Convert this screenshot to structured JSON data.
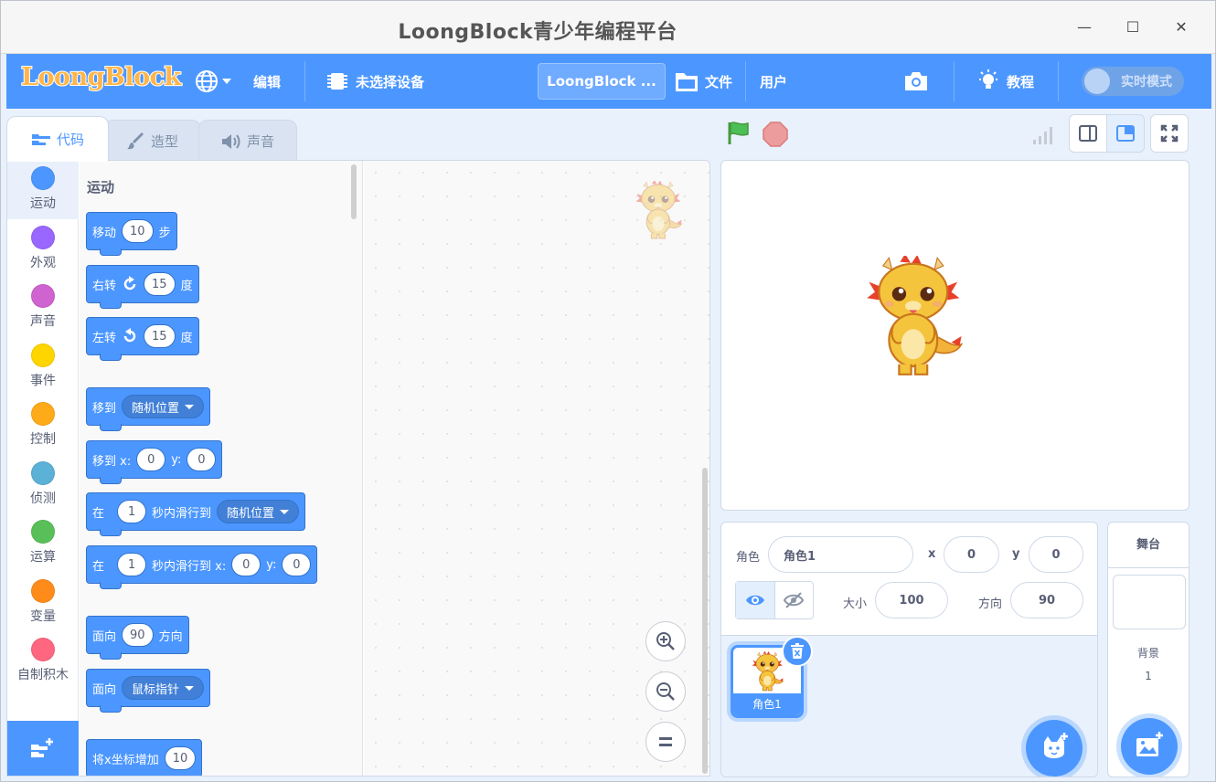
{
  "window": {
    "title": "LoongBlock青少年编程平台"
  },
  "menubar": {
    "logo": "LoongBlock",
    "edit": "编辑",
    "device": "未选择设备",
    "project_title": "LoongBlock ...",
    "file": "文件",
    "user": "用户",
    "tutorial": "教程",
    "realtime": "实时模式"
  },
  "tabs": {
    "code": "代码",
    "costume": "造型",
    "sound": "声音"
  },
  "categories": [
    {
      "label": "运动",
      "color": "#4c97ff"
    },
    {
      "label": "外观",
      "color": "#9966ff"
    },
    {
      "label": "声音",
      "color": "#cf63cf"
    },
    {
      "label": "事件",
      "color": "#ffd500"
    },
    {
      "label": "控制",
      "color": "#ffab19"
    },
    {
      "label": "侦测",
      "color": "#5cb1d6"
    },
    {
      "label": "运算",
      "color": "#59c059"
    },
    {
      "label": "变量",
      "color": "#ff8c1a"
    },
    {
      "label": "自制积木",
      "color": "#ff6680"
    }
  ],
  "palette": {
    "title": "运动",
    "move": {
      "a": "移动",
      "v": "10",
      "b": "步"
    },
    "turn_right": {
      "a": "右转",
      "v": "15",
      "b": "度"
    },
    "turn_left": {
      "a": "左转",
      "v": "15",
      "b": "度"
    },
    "goto": {
      "a": "移到",
      "dd": "随机位置"
    },
    "goto_xy": {
      "a": "移到 x:",
      "x": "0",
      "y_label": "y:",
      "y": "0"
    },
    "glide": {
      "a": "在",
      "v": "1",
      "b": "秒内滑行到",
      "dd": "随机位置"
    },
    "glide_xy": {
      "a": "在",
      "v": "1",
      "b": "秒内滑行到 x:",
      "x": "0",
      "y_label": "y:",
      "y": "0"
    },
    "point_dir": {
      "a": "面向",
      "v": "90",
      "b": "方向"
    },
    "point_towards": {
      "a": "面向",
      "dd": "鼠标指针"
    },
    "change_x": {
      "a": "将x坐标增加",
      "v": "10"
    }
  },
  "sprite_info": {
    "sprite_label": "角色",
    "sprite_name": "角色1",
    "x_label": "x",
    "x": "0",
    "y_label": "y",
    "y": "0",
    "size_label": "大小",
    "size": "100",
    "dir_label": "方向",
    "dir": "90"
  },
  "sprites": [
    {
      "name": "角色1"
    }
  ],
  "stage_panel": {
    "title": "舞台",
    "backdrop_label": "背景",
    "backdrop_count": "1"
  }
}
